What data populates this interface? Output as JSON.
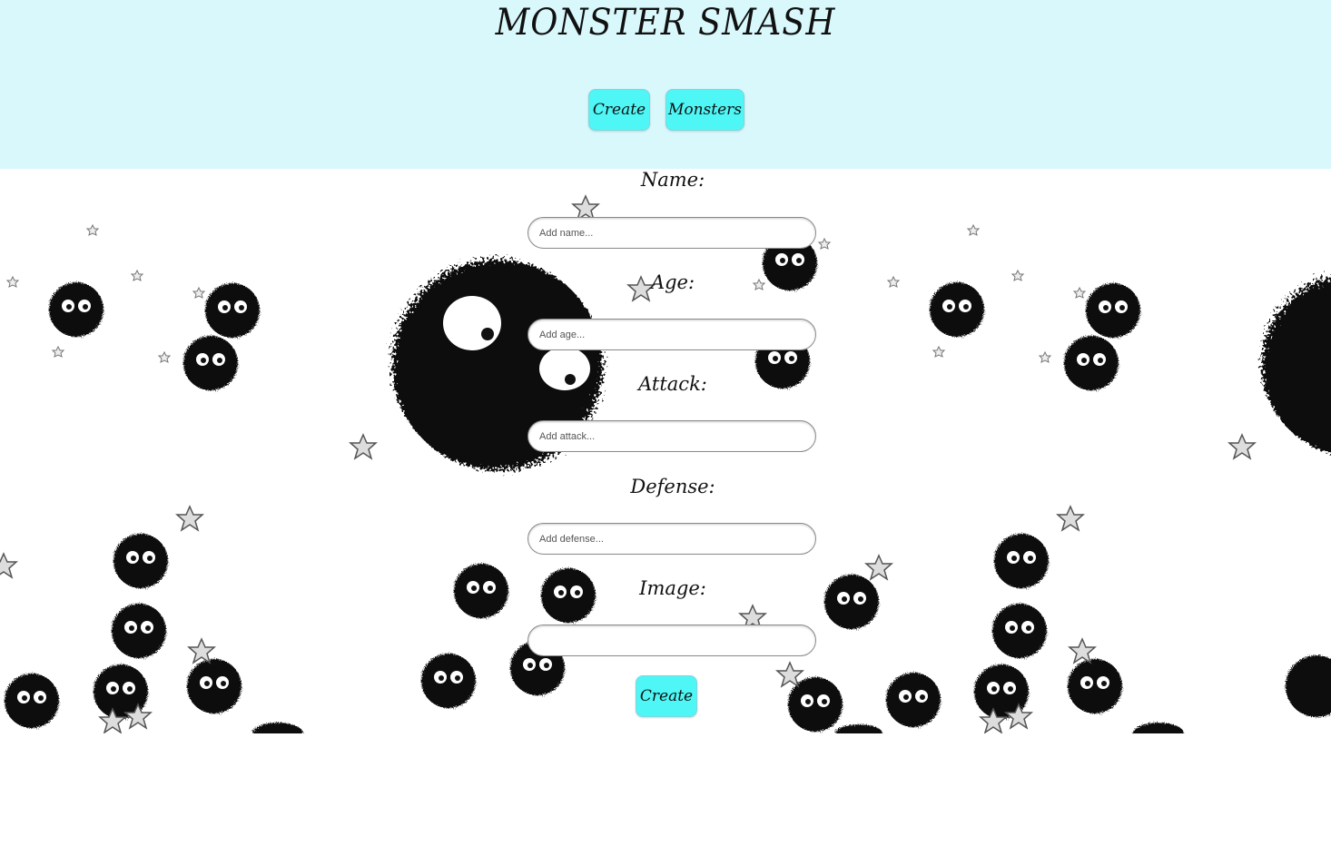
{
  "header": {
    "title": "MONSTER SMASH",
    "nav": {
      "create_label": "Create",
      "monsters_label": "Monsters"
    },
    "background_color": "#d9f8fc",
    "button_color": "#4ef6f6"
  },
  "form": {
    "fields": [
      {
        "label": "Name:",
        "placeholder": "Add name...",
        "value": ""
      },
      {
        "label": "Age:",
        "placeholder": "Add age...",
        "value": ""
      },
      {
        "label": "Attack:",
        "placeholder": "Add attack...",
        "value": ""
      },
      {
        "label": "Defense:",
        "placeholder": "Add defense...",
        "value": ""
      },
      {
        "label": "Image:",
        "placeholder": "",
        "value": ""
      }
    ],
    "submit_label": "Create"
  },
  "background": {
    "icon": "soot-sprites-illustration"
  }
}
